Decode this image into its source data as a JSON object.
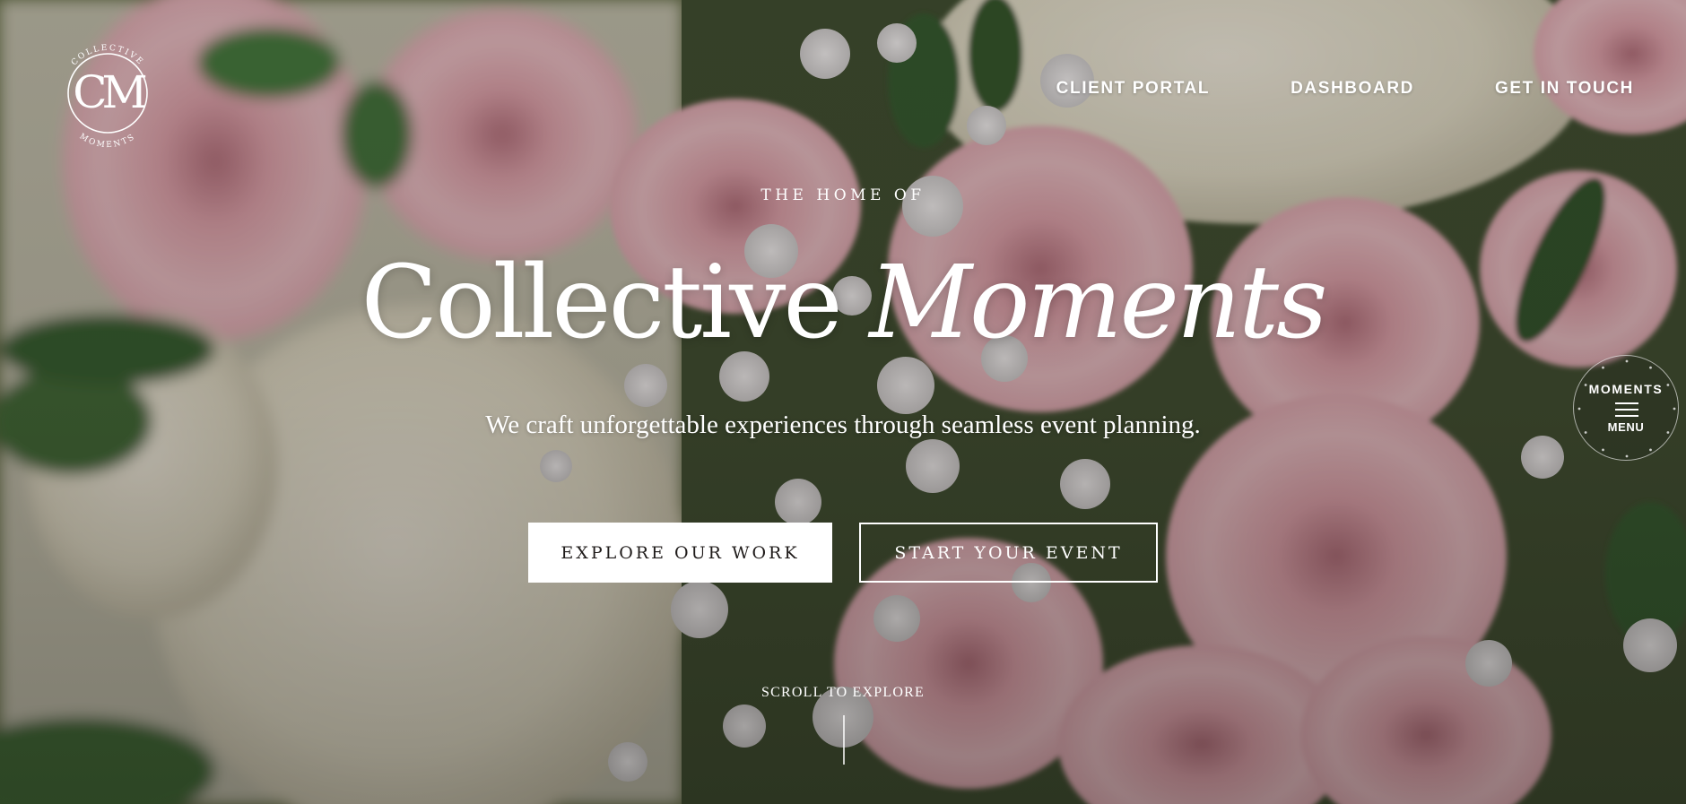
{
  "brand": {
    "monogram": "CM",
    "ring_top": "COLLECTIVE",
    "ring_bottom": "MOMENTS"
  },
  "nav": {
    "items": [
      {
        "label": "CLIENT PORTAL"
      },
      {
        "label": "DASHBOARD"
      },
      {
        "label": "GET IN TOUCH"
      }
    ]
  },
  "hero": {
    "eyebrow": "THE HOME OF",
    "headline_regular": "Collective",
    "headline_italic": "Moments",
    "subhead": "We craft unforgettable experiences through seamless event planning.",
    "primary_cta": "EXPLORE OUR WORK",
    "secondary_cta": "START YOUR EVENT",
    "scroll_hint": "SCROLL TO EXPLORE"
  },
  "menu_badge": {
    "top_label": "MOMENTS",
    "bottom_label": "MENU",
    "icon": "hamburger-icon"
  },
  "colors": {
    "text": "#ffffff",
    "primary_button_bg": "#ffffff",
    "primary_button_text": "#1f1b1a"
  }
}
